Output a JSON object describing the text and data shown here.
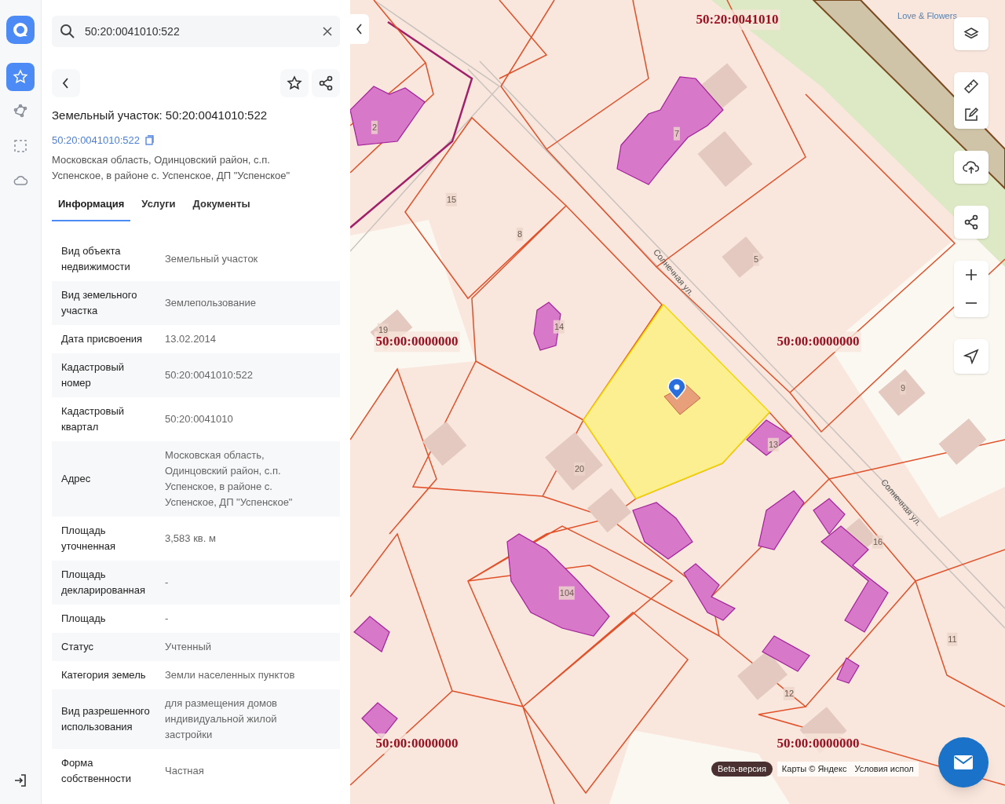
{
  "rail": {
    "items": [
      {
        "kind": "star",
        "selected": true
      },
      {
        "kind": "polygon",
        "selected": false
      },
      {
        "kind": "select",
        "selected": false
      },
      {
        "kind": "cloud",
        "selected": false
      }
    ]
  },
  "search": {
    "value": "50:20:0041010:522"
  },
  "card": {
    "title": "Земельный участок: 50:20:0041010:522",
    "number_link": "50:20:0041010:522",
    "address": "Московская область, Одинцовский район, с.п. Успенское, в районе с. Успенское, ДП \"Успенское\"",
    "tabs": [
      {
        "label": "Информация",
        "selected": true
      },
      {
        "label": "Услуги",
        "selected": false
      },
      {
        "label": "Документы",
        "selected": false
      }
    ],
    "rows": [
      {
        "label": "Вид объекта недвижимости",
        "value": "Земельный участок"
      },
      {
        "label": "Вид земельного участка",
        "value": "Землепользование"
      },
      {
        "label": "Дата присвоения",
        "value": "13.02.2014"
      },
      {
        "label": "Кадастровый номер",
        "value": "50:20:0041010:522"
      },
      {
        "label": "Кадастровый квартал",
        "value": "50:20:0041010"
      },
      {
        "label": "Адрес",
        "value": "Московская область, Одинцовский район, с.п. Успенское, в районе с. Успенское, ДП \"Успенское\""
      },
      {
        "label": "Площадь уточненная",
        "value": "3,583 кв. м"
      },
      {
        "label": "Площадь декларированная",
        "value": "-"
      },
      {
        "label": "Площадь",
        "value": "-"
      },
      {
        "label": "Статус",
        "value": "Учтенный"
      },
      {
        "label": "Категория земель",
        "value": "Земли населенных пунктов"
      },
      {
        "label": "Вид разрешенного использования",
        "value": "для размещения домов индивидуальной жилой застройки"
      },
      {
        "label": "Форма собственности",
        "value": "Частная"
      }
    ]
  },
  "map": {
    "quarter_labels": [
      "50:20:0041010",
      "50:00:0000000",
      "50:00:0000000",
      "50:00:0000000",
      "50:00:0000000"
    ],
    "house_numbers": [
      "2",
      "7",
      "15",
      "8",
      "5",
      "19",
      "14",
      "9",
      "20",
      "13",
      "16",
      "104",
      "11",
      "12"
    ],
    "street_labels": [
      "Солнечная ул.",
      "Солнечная ул."
    ],
    "poi_label": "Love & Flowers",
    "beta_badge": "Beta-версия",
    "attribution": "Карты © Яндекс",
    "terms_link": "Условия испол"
  }
}
